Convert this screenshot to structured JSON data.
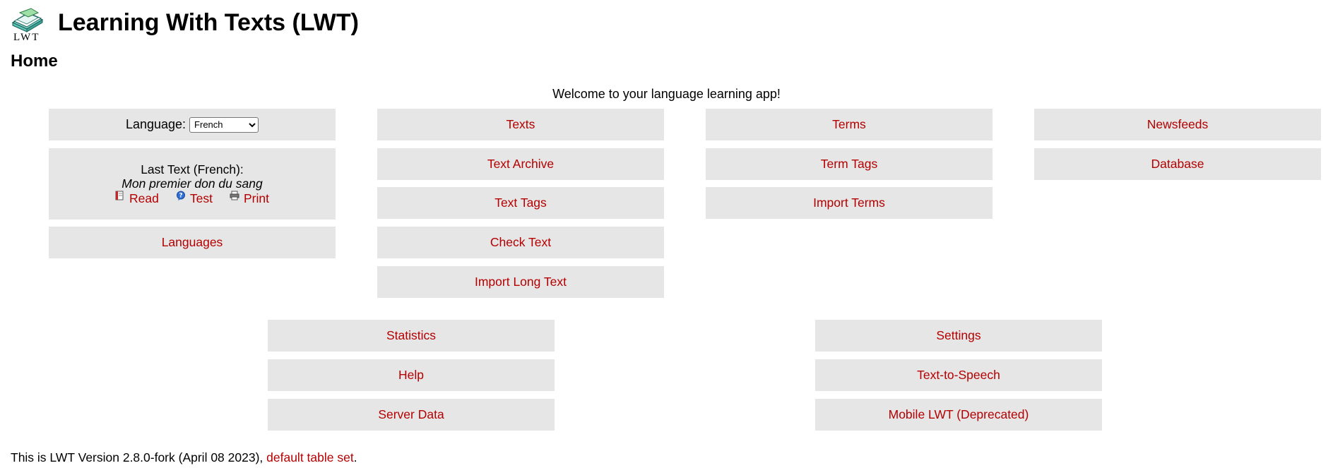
{
  "app_title": "Learning With Texts (LWT)",
  "logo_text": "LWT",
  "page_title": "Home",
  "welcome": "Welcome to your language learning app!",
  "language": {
    "label": "Language:",
    "selected": "French"
  },
  "last_text": {
    "heading": "Last Text (French):",
    "title": "Mon premier don du sang",
    "read": "Read",
    "test": "Test",
    "print": "Print"
  },
  "menu": {
    "languages": "Languages",
    "texts": "Texts",
    "text_archive": "Text Archive",
    "text_tags": "Text Tags",
    "check_text": "Check Text",
    "import_long_text": "Import Long Text",
    "terms": "Terms",
    "term_tags": "Term Tags",
    "import_terms": "Import Terms",
    "newsfeeds": "Newsfeeds",
    "database": "Database",
    "statistics": "Statistics",
    "help": "Help",
    "server_data": "Server Data",
    "settings": "Settings",
    "text_to_speech": "Text-to-Speech",
    "mobile_lwt": "Mobile LWT (Deprecated)"
  },
  "footer": {
    "prefix": "This is LWT Version 2.8.0-fork (April 08 2023), ",
    "link": "default table set",
    "suffix": "."
  },
  "colors": {
    "link": "#b40000",
    "box": "#e6e6e6"
  }
}
